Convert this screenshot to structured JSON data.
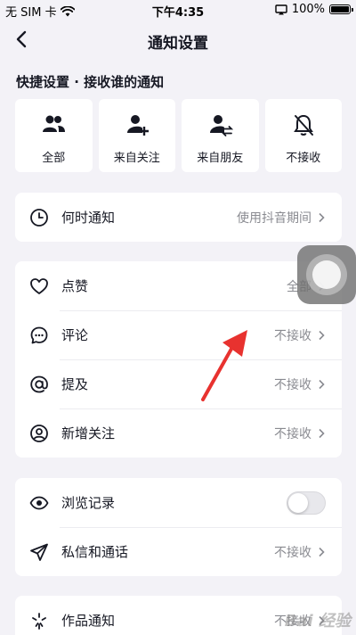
{
  "status_bar": {
    "carrier": "无 SIM 卡",
    "time": "下午4:35",
    "battery": "100%",
    "battery_level": 1.0
  },
  "nav": {
    "title": "通知设置"
  },
  "quick": {
    "title": "快捷设置 · 接收谁的通知",
    "items": [
      {
        "label": "全部",
        "icon": "group-icon"
      },
      {
        "label": "来自关注",
        "icon": "user-add-icon"
      },
      {
        "label": "来自朋友",
        "icon": "user-swap-icon"
      },
      {
        "label": "不接收",
        "icon": "bell-off-icon"
      }
    ]
  },
  "when": {
    "label": "何时通知",
    "value": "使用抖音期间",
    "icon": "clock-icon"
  },
  "interactions": [
    {
      "label": "点赞",
      "value": "全部",
      "icon": "heart-icon"
    },
    {
      "label": "评论",
      "value": "不接收",
      "icon": "comment-icon"
    },
    {
      "label": "提及",
      "value": "不接收",
      "icon": "at-icon"
    },
    {
      "label": "新增关注",
      "value": "不接收",
      "icon": "user-circle-icon"
    }
  ],
  "other": {
    "history": {
      "label": "浏览记录",
      "icon": "eye-icon",
      "enabled": false
    },
    "messages": {
      "label": "私信和通话",
      "value": "不接收",
      "icon": "send-icon"
    }
  },
  "works": {
    "label": "作品通知",
    "value": "不接收",
    "icon": "sparkle-icon"
  },
  "watermark": "Bai 经验"
}
